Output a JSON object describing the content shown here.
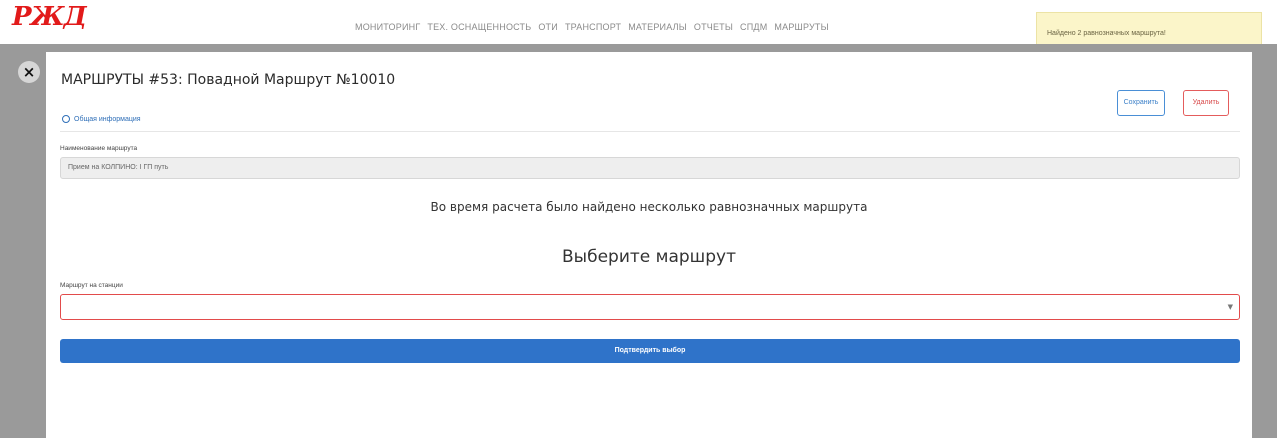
{
  "brand": {
    "logo": "РЖД",
    "color": "#e21a1a"
  },
  "nav": {
    "items": [
      "МОНИТОРИНГ",
      "ТЕХ. ОСНАЩЕННОСТЬ",
      "ОТИ",
      "ТРАНСПОРТ",
      "МАТЕРИАЛЫ",
      "ОТЧЕТЫ",
      "СПДМ",
      "МАРШРУТЫ"
    ]
  },
  "toast": {
    "text": "Найдено 2 равнозначных маршрута!"
  },
  "modal": {
    "close_icon": "×",
    "title": "МАРШРУТЫ #53: Повадной Маршрут №10010",
    "save_label": "Сохранить",
    "delete_label": "Удалить",
    "info_tab": "Общая информация",
    "route_name_label": "Наименование маршрута",
    "route_name_value": "Прием на КОЛПИНО: I ГП путь",
    "message": "Во время расчета было найдено несколько равнозначных маршрута",
    "heading": "Выберите маршрут",
    "station_route_label": "Маршрут на станции",
    "station_route_value": "",
    "confirm_label": "Подтвердить выбор"
  },
  "colors": {
    "accent": "#2f73c9",
    "danger": "#e24b4b",
    "toast_bg": "#fbf5c9"
  }
}
